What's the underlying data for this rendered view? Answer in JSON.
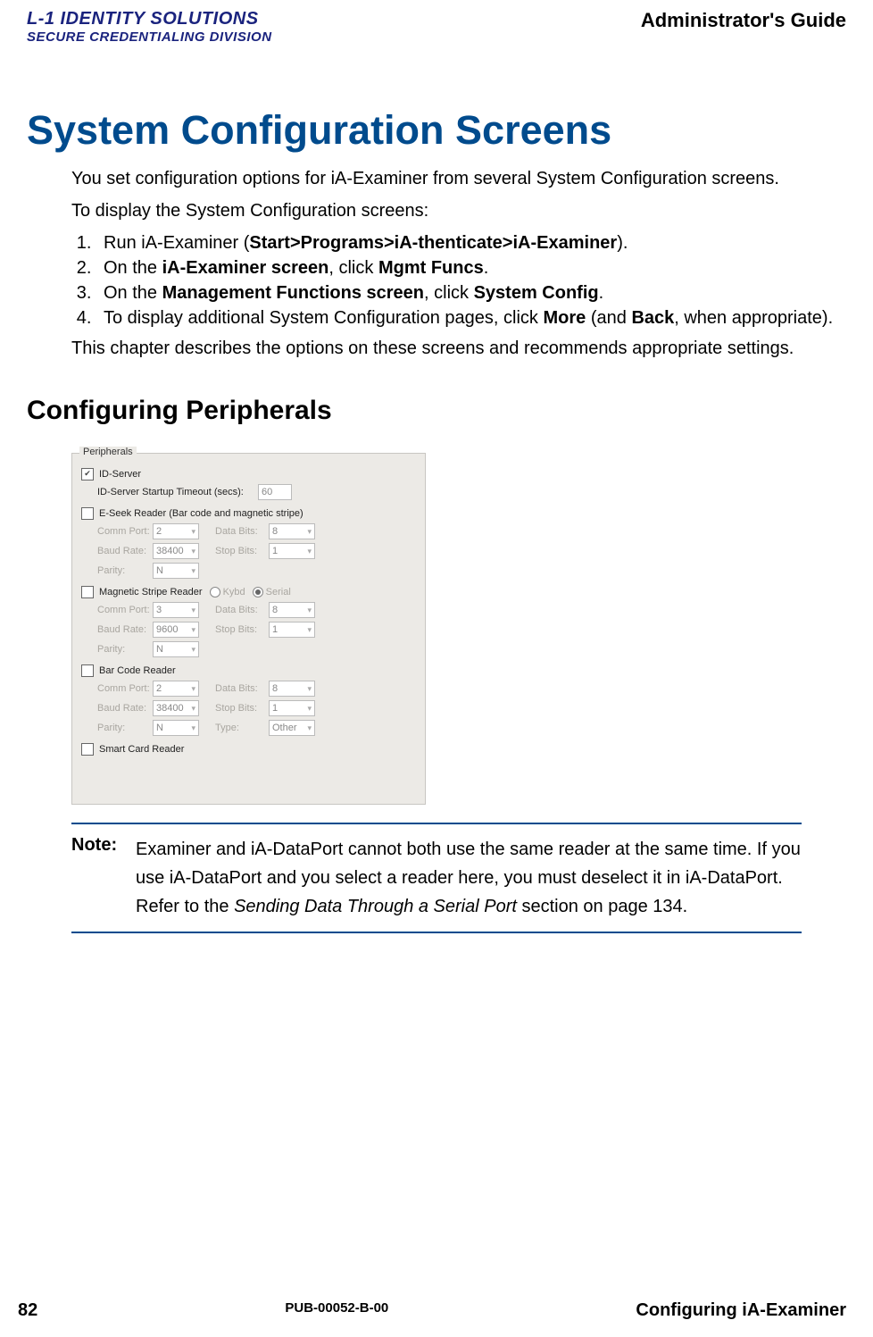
{
  "header": {
    "logo_line1": "L-1 IDENTITY SOLUTIONS",
    "logo_line2": "SECURE CREDENTIALING DIVISION",
    "guide_title": "Administrator's Guide"
  },
  "chapter_title": "System Configuration Screens",
  "intro1": "You set configuration options for iA-Examiner from several System Configuration screens.",
  "intro2": "To display the System Configuration screens:",
  "steps": {
    "s1_pre": "Run iA-Examiner (",
    "s1_bold": "Start>Programs>iA-thenticate>iA-Examiner",
    "s1_post": ").",
    "s2_pre": "On the ",
    "s2_bold1": "iA-Examiner screen",
    "s2_mid": ", click ",
    "s2_bold2": "Mgmt Funcs",
    "s2_post": ".",
    "s3_pre": "On the ",
    "s3_bold1": "Management Functions screen",
    "s3_mid": ", click ",
    "s3_bold2": "System Config",
    "s3_post": ".",
    "s4_pre": "To display additional System Configuration pages, click ",
    "s4_bold1": "More",
    "s4_mid": " (and ",
    "s4_bold2": "Back",
    "s4_post": ", when appropriate)."
  },
  "intro3": "This chapter describes the options on these screens and recommends appropriate settings.",
  "section_title": "Configuring Peripherals",
  "panel": {
    "frame": "Peripherals",
    "idserver": "ID-Server",
    "idserver_checked": "✔",
    "timeout_lbl": "ID-Server Startup Timeout (secs):",
    "timeout_val": "60",
    "eseek": "E-Seek Reader  (Bar code and magnetic stripe)",
    "commport": "Comm Port:",
    "baudrate": "Baud Rate:",
    "parity": "Parity:",
    "databits": "Data Bits:",
    "stopbits": "Stop Bits:",
    "type": "Type:",
    "magstripe": "Magnetic Stripe Reader",
    "kybd": "Kybd",
    "serial": "Serial",
    "barcode": "Bar Code Reader",
    "smartcard": "Smart Card Reader",
    "vals": {
      "cp2": "2",
      "cp3": "3",
      "br38400": "38400",
      "br9600": "9600",
      "pN": "N",
      "db8": "8",
      "sb1": "1",
      "other": "Other"
    }
  },
  "note": {
    "label": "Note:",
    "text_pre": "Examiner and iA-DataPort cannot both use the same reader at the same time. If you use iA-DataPort and you select a reader here, you must deselect it in iA-DataPort. Refer to the ",
    "text_ital": "Sending Data Through a Serial Port",
    "text_post": " section on page 134."
  },
  "footer": {
    "page": "82",
    "pub": "PUB-00052-B-00",
    "section": "Configuring iA-Examiner"
  }
}
